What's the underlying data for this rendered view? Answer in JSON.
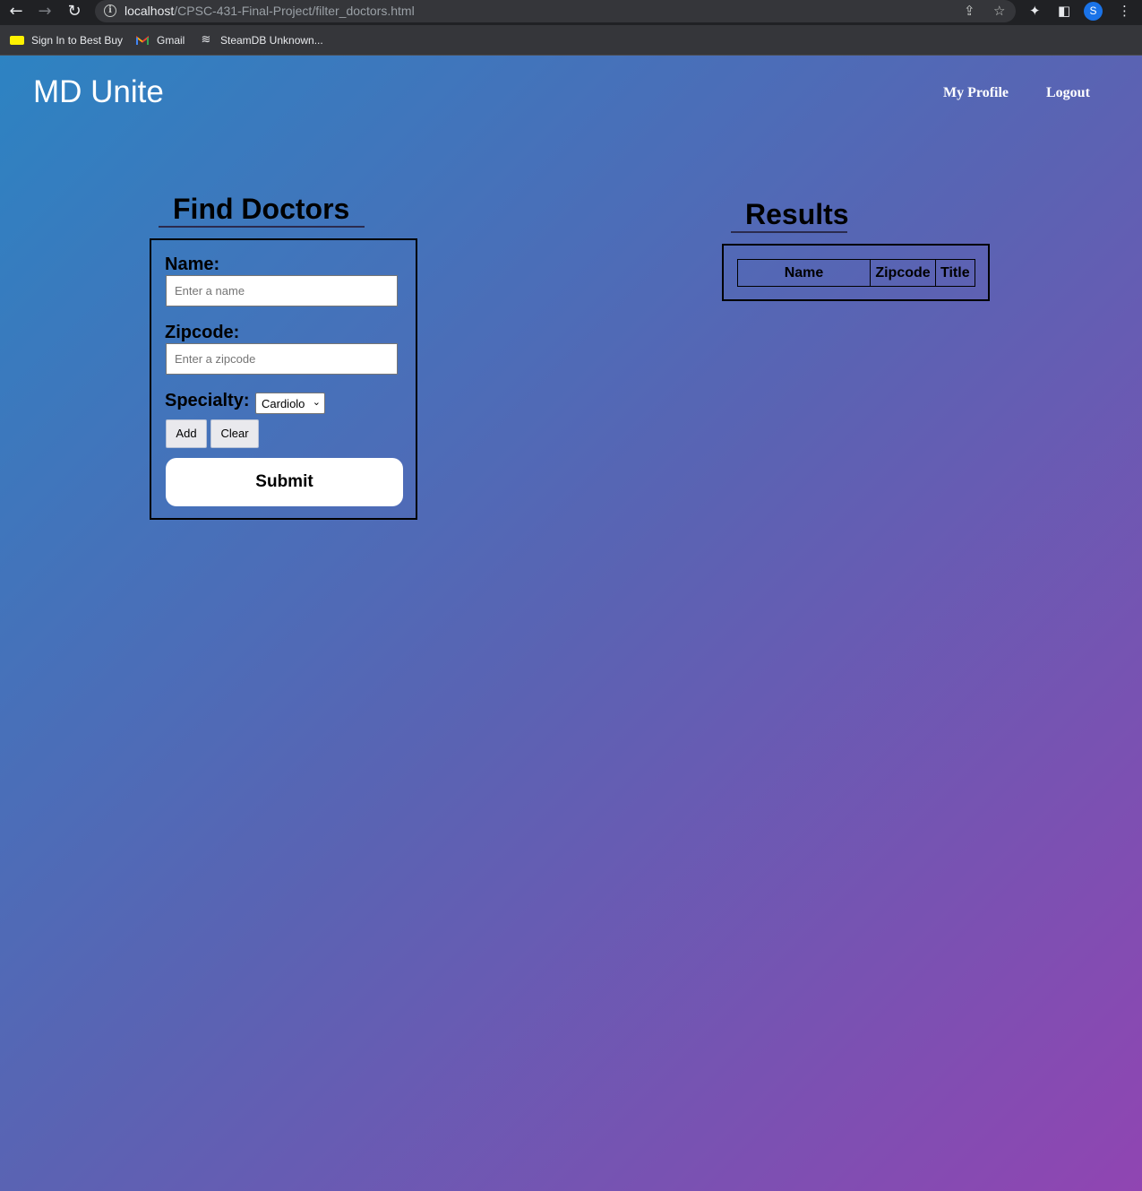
{
  "browser": {
    "url_host": "localhost",
    "url_path": "/CPSC-431-Final-Project/filter_doctors.html",
    "profile_initial": "S",
    "bookmarks": [
      "Sign In to Best Buy",
      "Gmail",
      "SteamDB Unknown..."
    ]
  },
  "header": {
    "brand": "MD Unite",
    "nav": [
      "My Profile",
      "Logout"
    ]
  },
  "find": {
    "title": "Find Doctors",
    "name_label": "Name:",
    "name_placeholder": "Enter a name",
    "zipcode_label": "Zipcode:",
    "zipcode_placeholder": "Enter a zipcode",
    "specialty_label": "Specialty:",
    "specialty_selected": "Cardiolo",
    "add_label": "Add",
    "clear_label": "Clear",
    "submit_label": "Submit"
  },
  "results": {
    "title": "Results",
    "columns": [
      "Name",
      "Zipcode",
      "Title"
    ]
  },
  "colors": {
    "gradient_start": "#2d83c2",
    "gradient_end": "#9045b2"
  }
}
